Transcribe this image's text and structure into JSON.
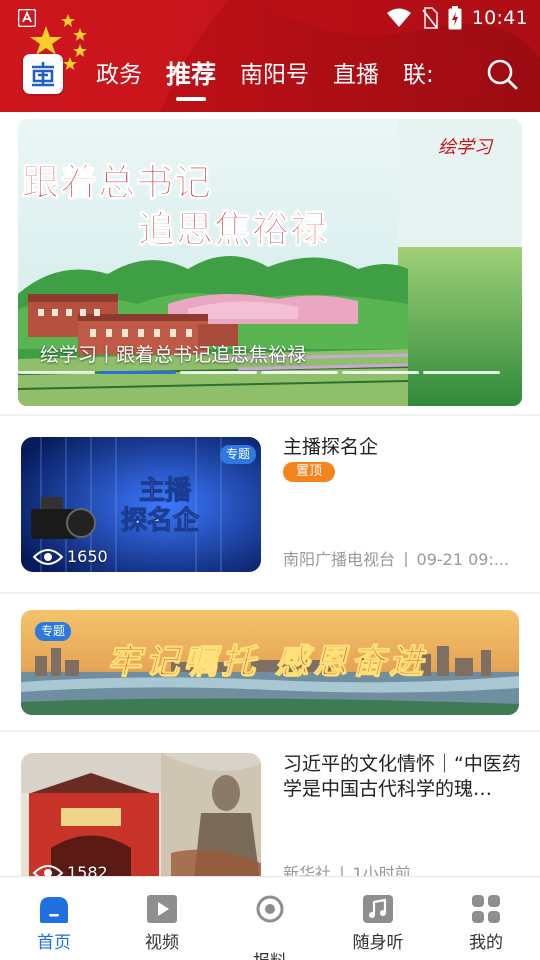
{
  "status_bar": {
    "time": "10:41"
  },
  "header": {
    "tabs": [
      {
        "label": "政务",
        "active": false
      },
      {
        "label": "推荐",
        "active": true
      },
      {
        "label": "南阳号",
        "active": false
      },
      {
        "label": "直播",
        "active": false
      },
      {
        "label": "联:",
        "active": false
      }
    ],
    "accent_color": "#b70f16"
  },
  "banner": {
    "headline_line1": "跟着总书记",
    "headline_line2": "追思焦裕禄",
    "brand": "绘学习",
    "caption": "绘学习丨跟着总书记追思焦裕禄",
    "slide_count": 6,
    "active_slide": 1
  },
  "feed": [
    {
      "type": "video",
      "title": "主播探名企",
      "badge": "专题",
      "pin_label": "置顶",
      "views": "1650",
      "source": "南阳广播电视台",
      "time": "09-21 09:..."
    },
    {
      "type": "topic-banner",
      "badge": "专题",
      "banner_text": "牢记嘱托  感恩奋进"
    },
    {
      "type": "article",
      "title": "习近平的文化情怀｜“中医药学是中国古代科学的瑰…",
      "views": "1582",
      "source": "新华社",
      "time": "1小时前"
    }
  ],
  "bottom_nav": [
    {
      "label": "首页",
      "icon": "home-icon",
      "active": true
    },
    {
      "label": "视频",
      "icon": "video-icon",
      "active": false
    },
    {
      "label": "报料",
      "icon": "report-icon",
      "active": false
    },
    {
      "label": "随身听",
      "icon": "music-icon",
      "active": false
    },
    {
      "label": "我的",
      "icon": "mine-icon",
      "active": false
    }
  ],
  "colors": {
    "active_blue": "#1e6fe0",
    "pin_orange": "#f5831f",
    "topic_blue": "#2e79e0"
  }
}
